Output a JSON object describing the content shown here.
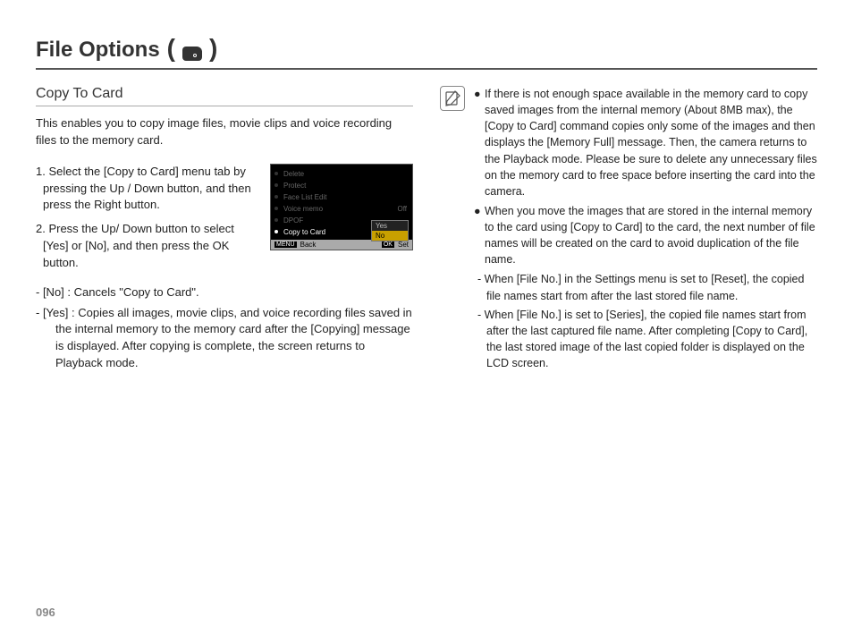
{
  "header": {
    "title": "File Options",
    "paren_open": "(",
    "paren_close": ")",
    "icon_name": "file-options-icon"
  },
  "left": {
    "subhead": "Copy To Card",
    "intro": "This enables you to copy image files, movie clips and voice recording files to the memory card.",
    "step1_num": "1.",
    "step1": " Select the [Copy to Card] menu tab by pressing the Up / Down button, and then press the Right button.",
    "step2_num": "2.",
    "step2": " Press the Up/ Down button to select [Yes] or [No], and then press the OK button.",
    "sub_no_tag": "- [No]  :",
    "sub_no": " Cancels \"Copy to Card\".",
    "sub_yes_tag": "- [Yes] :",
    "sub_yes": " Copies all images, movie clips, and voice recording files saved in the internal memory to the memory card after the [Copying] message is displayed. After copying is complete, the screen returns to Playback mode."
  },
  "lcd": {
    "items": [
      "Delete",
      "Protect",
      "Face List Edit",
      "Voice memo",
      "DPOF",
      "Copy to Card"
    ],
    "voice_val": "Off",
    "popup": {
      "yes": "Yes",
      "no": "No"
    },
    "foot": {
      "back_key": "MENU",
      "back": "Back",
      "set_key": "OK",
      "set": "Set"
    }
  },
  "right": {
    "b1": "If there is not enough space available in the memory card to copy saved images from the internal memory (About 8MB max), the [Copy to Card] command copies only some of the images and then displays the [Memory Full] message. Then, the camera returns to the Playback mode. Please be sure to delete any unnecessary files on the memory card to free space before inserting the card into the camera.",
    "b2": "When you move the images that are stored in the internal memory to the card using [Copy to Card] to the card, the next number of file names will be created on the card to avoid duplication of the file name.",
    "d1": "- When [File No.] in the Settings menu is set to [Reset], the copied file names start from after the last stored file name.",
    "d2": "- When [File No.] is set to [Series], the copied file names start from after the last captured file name. After completing [Copy to Card], the last stored image of the last copied folder is displayed on the LCD screen."
  },
  "page_number": "096"
}
